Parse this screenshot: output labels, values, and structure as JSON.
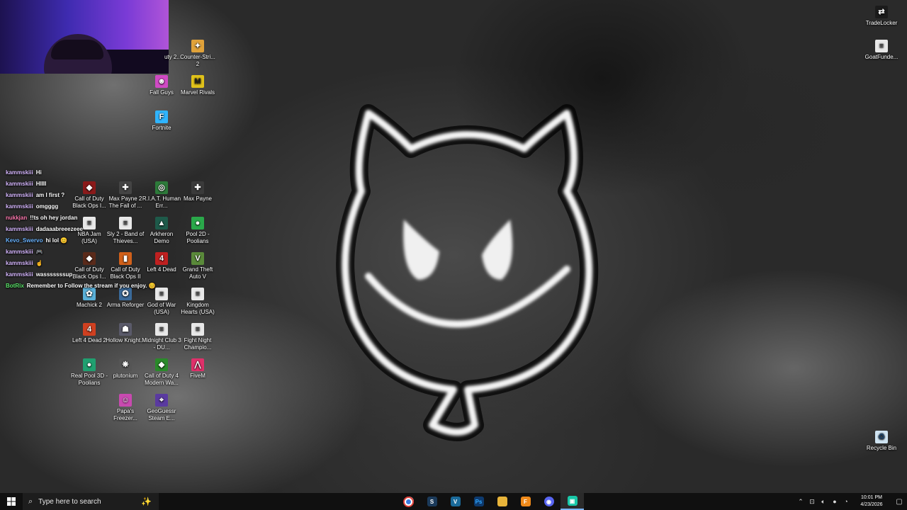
{
  "desktop": {
    "icons_right": [
      {
        "id": "tradelocker",
        "label": "TradeLocker",
        "icon": "tradelocker-icon",
        "color": "#1b1b1b"
      },
      {
        "id": "goatfunded",
        "label": "GoatFunde...",
        "icon": "document-icon",
        "color": "#e8e8e8"
      },
      {
        "id": "recycle-bin",
        "label": "Recycle Bin",
        "icon": "recycle-bin-icon",
        "color": "#cfe4f2"
      }
    ],
    "icons_left": [
      {
        "id": "partial-1",
        "label": "uty\n2...",
        "icon": "game-icon",
        "color": "#333333"
      },
      {
        "id": "counterstrike",
        "label": "Counter-Stri... 2",
        "icon": "counter-strike-icon",
        "color": "#e0a23a"
      },
      {
        "id": "fallguys",
        "label": "Fall Guys",
        "icon": "fall-guys-icon",
        "color": "#d04ac4"
      },
      {
        "id": "marvelrivals",
        "label": "Marvel Rivals",
        "icon": "marvel-rivals-icon",
        "color": "#e0c21a"
      },
      {
        "id": "fortnite",
        "label": "Fortnite",
        "icon": "fortnite-icon",
        "color": "#2fb4ff"
      },
      {
        "id": "codbo",
        "label": "Call of Duty Black Ops I...",
        "icon": "cod-icon",
        "color": "#8a1a1a"
      },
      {
        "id": "maxpayne2",
        "label": "Max Payne 2 The Fall of ...",
        "icon": "max-payne-icon",
        "color": "#444444"
      },
      {
        "id": "riat",
        "label": "R.I.A.T. Human Err...",
        "icon": "game-icon",
        "color": "#2d7a3a"
      },
      {
        "id": "maxpayne",
        "label": "Max Payne",
        "icon": "max-payne-icon",
        "color": "#3a3a3a"
      },
      {
        "id": "nbajam",
        "label": "NBA Jam (USA)",
        "icon": "document-icon",
        "color": "#e8e8e8"
      },
      {
        "id": "sly2",
        "label": "Sly 2 - Band of Thieves...",
        "icon": "document-icon",
        "color": "#e8e8e8"
      },
      {
        "id": "arkheron",
        "label": "Arkheron Demo",
        "icon": "game-icon",
        "color": "#1e5a4a"
      },
      {
        "id": "pool2d",
        "label": "Pool 2D - Poolians",
        "icon": "pool-icon",
        "color": "#2aa84a"
      },
      {
        "id": "codbo1",
        "label": "Call of Duty Black Ops I...",
        "icon": "cod-icon",
        "color": "#5a2a1a"
      },
      {
        "id": "codbo2",
        "label": "Call of Duty Black Ops II",
        "icon": "cod-icon",
        "color": "#d0601a"
      },
      {
        "id": "l4d",
        "label": "Left 4 Dead",
        "icon": "left4dead-icon",
        "color": "#c02020"
      },
      {
        "id": "gta5",
        "label": "Grand Theft Auto V",
        "icon": "gta-icon",
        "color": "#5a8a3a"
      },
      {
        "id": "machick2",
        "label": "Machick 2",
        "icon": "game-icon",
        "color": "#5ab0d8"
      },
      {
        "id": "armareforger",
        "label": "Arma Reforger",
        "icon": "game-icon",
        "color": "#3a6a9a"
      },
      {
        "id": "gow",
        "label": "God of War (USA)",
        "icon": "document-icon",
        "color": "#e8e8e8"
      },
      {
        "id": "kh",
        "label": "Kingdom Hearts (USA)",
        "icon": "document-icon",
        "color": "#e8e8e8"
      },
      {
        "id": "l4d2",
        "label": "Left 4 Dead 2",
        "icon": "left4dead-icon",
        "color": "#d04020"
      },
      {
        "id": "hollowknight",
        "label": "Hollow Knight...",
        "icon": "game-icon",
        "color": "#5a5a6a"
      },
      {
        "id": "midnightclub",
        "label": "Midnight Club 3 - DU...",
        "icon": "document-icon",
        "color": "#e8e8e8"
      },
      {
        "id": "fightnight",
        "label": "Fight Night Champio...",
        "icon": "document-icon",
        "color": "#e8e8e8"
      },
      {
        "id": "realpool",
        "label": "Real Pool 3D - Poolians",
        "icon": "pool-icon",
        "color": "#20a070"
      },
      {
        "id": "plutonium",
        "label": "plutonium",
        "icon": "plutonium-icon",
        "color": "#555555"
      },
      {
        "id": "cod4",
        "label": "Call of Duty 4 Modern Wa...",
        "icon": "cod-icon",
        "color": "#2a8a2a"
      },
      {
        "id": "fivem",
        "label": "FiveM",
        "icon": "fivem-icon",
        "color": "#e0306a"
      },
      {
        "id": "papas",
        "label": "Papa's Freezer...",
        "icon": "game-icon",
        "color": "#c84ab0"
      },
      {
        "id": "geoguessr",
        "label": "GeoGuessr Steam E...",
        "icon": "geoguessr-icon",
        "color": "#5a3aa0"
      }
    ]
  },
  "chat": {
    "messages": [
      {
        "user": "kammskiii",
        "text": "Hi",
        "color": "#d6b7ff"
      },
      {
        "user": "kammskiii",
        "text": "HIIII",
        "color": "#d6b7ff"
      },
      {
        "user": "kammskiii",
        "text": "am I first ?",
        "color": "#d6b7ff"
      },
      {
        "user": "kammskiii",
        "text": "omgggg",
        "color": "#d6b7ff"
      },
      {
        "user": "nukkjan",
        "text": "!!ts oh hey jordan",
        "color": "#ff7ab0"
      },
      {
        "user": "kammskiii",
        "text": "dadaaabreeezeee",
        "color": "#d6b7ff"
      },
      {
        "user": "Kevo_Swervo",
        "text": "hi lol 😊",
        "color": "#6ab4ff"
      },
      {
        "user": "kammskiii",
        "text": "🎮",
        "color": "#d6b7ff"
      },
      {
        "user": "kammskiii",
        "text": "☝",
        "color": "#d6b7ff"
      },
      {
        "user": "kammskiii",
        "text": "wasssssssup",
        "color": "#d6b7ff"
      },
      {
        "user": "BotRix",
        "text": "Remember to Follow the stream if you enjoy. 😊",
        "color": "#5be36a"
      }
    ]
  },
  "taskbar": {
    "search_placeholder": "Type here to search",
    "apps": [
      {
        "id": "chrome",
        "icon": "chrome-icon",
        "glyph": "●",
        "color": "#e0403a"
      },
      {
        "id": "steam",
        "icon": "steam-icon",
        "glyph": "S",
        "color": "#1b3a5a"
      },
      {
        "id": "vegas",
        "icon": "vegas-icon",
        "glyph": "V",
        "color": "#1a6a9a"
      },
      {
        "id": "photoshop",
        "icon": "photoshop-icon",
        "glyph": "Ps",
        "color": "#0d3a6e"
      },
      {
        "id": "explorer",
        "icon": "folder-icon",
        "glyph": "▬",
        "color": "#e8b43a"
      },
      {
        "id": "flstudio",
        "icon": "fl-studio-icon",
        "glyph": "F",
        "color": "#f08a1a"
      },
      {
        "id": "discord",
        "icon": "discord-icon",
        "glyph": "◉",
        "color": "#5865f2"
      },
      {
        "id": "app-active",
        "icon": "app-icon",
        "glyph": "▣",
        "color": "#18c8a8"
      }
    ],
    "time": "10:01 PM",
    "date": "4/23/2026"
  }
}
